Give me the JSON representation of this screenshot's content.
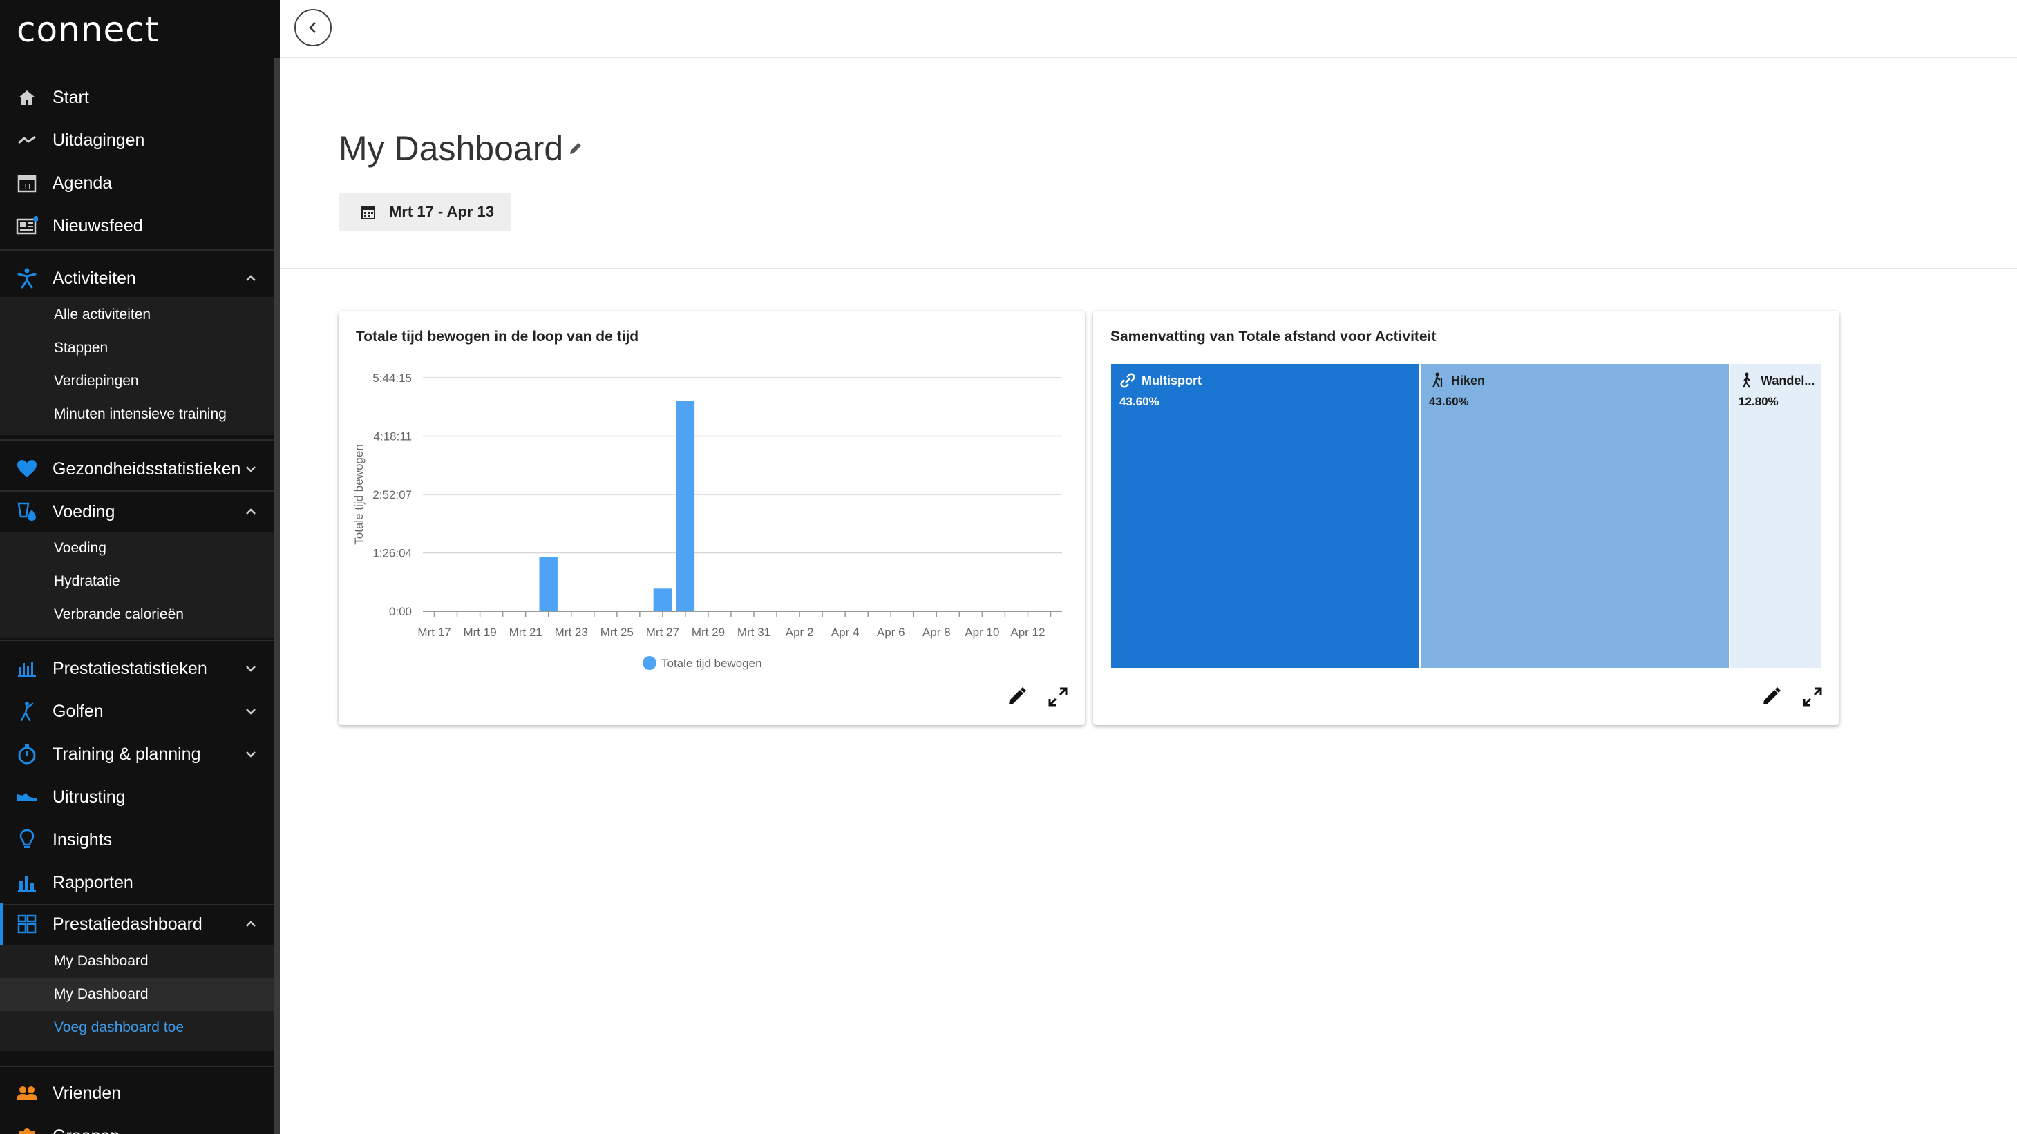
{
  "app": {
    "logo": "connect"
  },
  "nav": {
    "top": [
      {
        "label": "Start",
        "icon": "home-icon"
      },
      {
        "label": "Uitdagingen",
        "icon": "challenge-icon"
      },
      {
        "label": "Agenda",
        "icon": "calendar-icon",
        "badge": "31"
      },
      {
        "label": "Nieuwsfeed",
        "icon": "newsfeed-icon"
      }
    ],
    "activiteiten": {
      "label": "Activiteiten",
      "subs": [
        "Alle activiteiten",
        "Stappen",
        "Verdiepingen",
        "Minuten intensieve training"
      ]
    },
    "gezondheid": {
      "label": "Gezondheidsstatistieken"
    },
    "voeding": {
      "label": "Voeding",
      "subs": [
        "Voeding",
        "Hydratatie",
        "Verbrande calorieën"
      ]
    },
    "prestatiestatistieken": {
      "label": "Prestatiestatistieken"
    },
    "golfen": {
      "label": "Golfen"
    },
    "training": {
      "label": "Training & planning"
    },
    "uitrusting": {
      "label": "Uitrusting"
    },
    "insights": {
      "label": "Insights"
    },
    "rapporten": {
      "label": "Rapporten"
    },
    "prestatiedashboard": {
      "label": "Prestatiedashboard",
      "subs": [
        "My Dashboard",
        "My Dashboard"
      ],
      "add_link": "Voeg dashboard toe"
    },
    "vrienden": {
      "label": "Vrienden"
    },
    "groepen": {
      "label": "Groepen"
    }
  },
  "header": {
    "title": "My Dashboard",
    "date_range": "Mrt 17 - Apr 13"
  },
  "cards": {
    "bar": {
      "title": "Totale tijd bewogen in de loop van de tijd"
    },
    "treemap": {
      "title": "Samenvatting van Totale afstand voor Activiteit",
      "tiles": [
        {
          "name": "Multisport",
          "pct": "43.60%",
          "value": 43.6,
          "color": "#1b76d2",
          "text_color": "#ffffff",
          "icon": "multisport-icon"
        },
        {
          "name": "Hiken",
          "pct": "43.60%",
          "value": 43.6,
          "color": "#7fb1e3",
          "text_color": "#1a1a1a",
          "icon": "hiking-icon"
        },
        {
          "name": "Wandel...",
          "pct": "12.80%",
          "value": 12.8,
          "color": "#e3eef9",
          "text_color": "#1a1a1a",
          "icon": "walking-icon"
        }
      ]
    }
  },
  "chart_data": {
    "type": "bar",
    "title": "Totale tijd bewogen in de loop van de tijd",
    "ylabel": "Totale tijd bewogen",
    "xlabel": "",
    "y_ticks": [
      {
        "label": "0:00",
        "seconds": 0
      },
      {
        "label": "1:26:04",
        "seconds": 5164
      },
      {
        "label": "2:52:07",
        "seconds": 10327
      },
      {
        "label": "4:18:11",
        "seconds": 15491
      },
      {
        "label": "5:44:15",
        "seconds": 20655
      }
    ],
    "ylim_seconds": [
      0,
      20655
    ],
    "x_tick_labels": [
      "Mrt 17",
      "Mrt 19",
      "Mrt 21",
      "Mrt 23",
      "Mrt 25",
      "Mrt 27",
      "Mrt 29",
      "Mrt 31",
      "Apr 2",
      "Apr 4",
      "Apr 6",
      "Apr 8",
      "Apr 10",
      "Apr 12"
    ],
    "categories": [
      "Mrt 17",
      "Mrt 18",
      "Mrt 19",
      "Mrt 20",
      "Mrt 21",
      "Mrt 22",
      "Mrt 23",
      "Mrt 24",
      "Mrt 25",
      "Mrt 26",
      "Mrt 27",
      "Mrt 28",
      "Mrt 29",
      "Mrt 30",
      "Mrt 31",
      "Apr 1",
      "Apr 2",
      "Apr 3",
      "Apr 4",
      "Apr 5",
      "Apr 6",
      "Apr 7",
      "Apr 8",
      "Apr 9",
      "Apr 10",
      "Apr 11",
      "Apr 12",
      "Apr 13"
    ],
    "series": [
      {
        "name": "Totale tijd bewogen",
        "color": "#4ea3f5",
        "values_seconds": [
          0,
          0,
          0,
          0,
          0,
          4800,
          0,
          0,
          0,
          0,
          0,
          0,
          0,
          0,
          0,
          0,
          0,
          0,
          0,
          0,
          0,
          0,
          0,
          0,
          0,
          0,
          0,
          0
        ]
      }
    ],
    "bars": [
      {
        "date": "Mrt 22",
        "seconds": 4800
      },
      {
        "date": "Mrt 27",
        "seconds": 2000
      },
      {
        "date": "Mrt 28",
        "seconds": 18600
      }
    ],
    "legend": "bottom-center",
    "grid": true
  }
}
